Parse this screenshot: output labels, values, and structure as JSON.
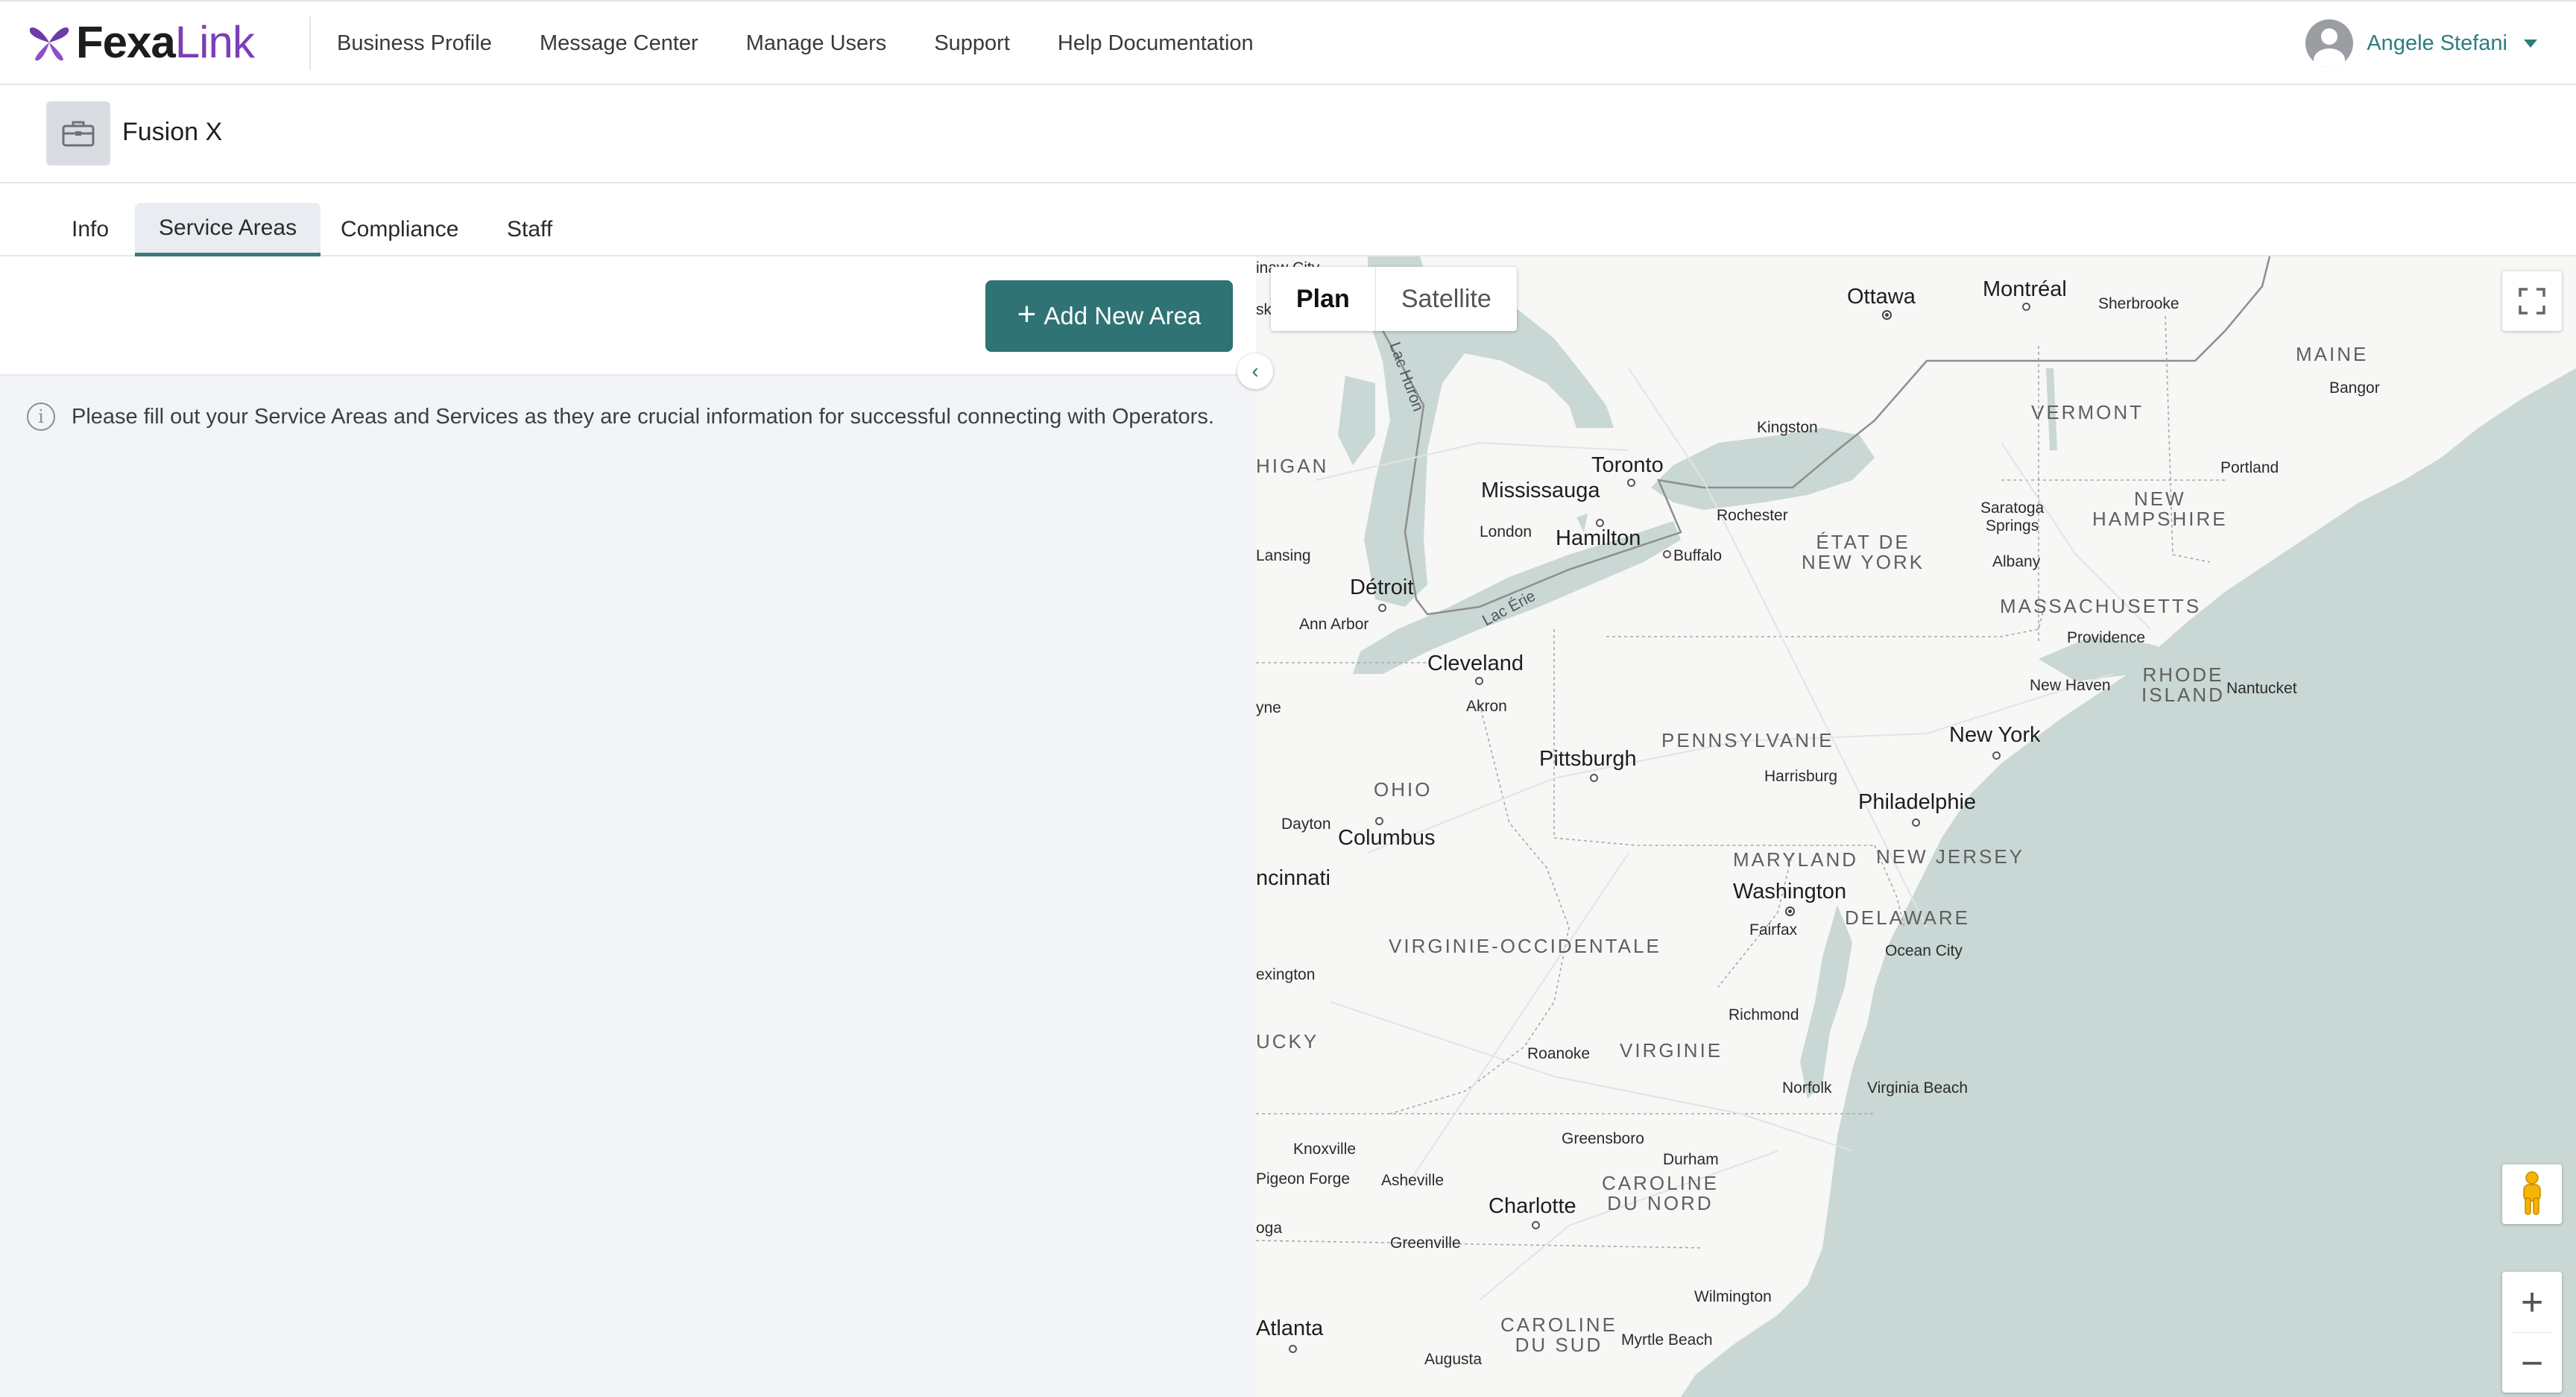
{
  "brand": {
    "part1": "Fexa",
    "part2": "Link",
    "accent": "#7b3fb6"
  },
  "nav": {
    "items": [
      "Business Profile",
      "Message Center",
      "Manage Users",
      "Support",
      "Help Documentation"
    ],
    "user_name": "Angele Stefani"
  },
  "business": {
    "name": "Fusion X",
    "icon": "briefcase-icon"
  },
  "tabs": [
    {
      "label": "Info",
      "active": false
    },
    {
      "label": "Service Areas",
      "active": true
    },
    {
      "label": "Compliance",
      "active": false
    },
    {
      "label": "Staff",
      "active": false
    }
  ],
  "panel": {
    "add_button": "Add New Area",
    "info_message": "Please fill out your Service Areas and Services as they are crucial information for successful connecting with Operators."
  },
  "map": {
    "type_options": {
      "plan": "Plan",
      "satellite": "Satellite",
      "selected": "Plan"
    },
    "colors": {
      "land": "#f7f7f5",
      "water": "#c9d7d5",
      "accent": "#2f7374"
    },
    "labels": {
      "ottawa": "Ottawa",
      "montreal": "Montréal",
      "sherbrooke": "Sherbrooke",
      "maine": "MAINE",
      "bangor": "Bangor",
      "vermont": "VERMONT",
      "kingston": "Kingston",
      "toronto": "Toronto",
      "mississauga": "Mississauga",
      "hamilton": "Hamilton",
      "london": "London",
      "rochester": "Rochester",
      "buffalo": "Buffalo",
      "saratoga": "Saratoga\nSprings",
      "new_hampshire": "NEW\nHAMPSHIRE",
      "portland": "Portland",
      "etat_ny": "ÉTAT DE\nNEW YORK",
      "albany": "Albany",
      "lansing": "Lansing",
      "detroit": "Détroit",
      "ann_arbor": "Ann Arbor",
      "lac_erie": "Lac Érie",
      "lac_huron": "Lac Huron",
      "higan": "HIGAN",
      "massachusetts": "MASSACHUSETTS",
      "providence": "Providence",
      "rhode_island": "RHODE\nISLAND",
      "nantucket": "Nantucket",
      "cleveland": "Cleveland",
      "new_haven": "New Haven",
      "akron": "Akron",
      "yne": "yne",
      "new_york": "New York",
      "pennsylvanie": "PENNSYLVANIE",
      "pittsburgh": "Pittsburgh",
      "harrisburg": "Harrisburg",
      "ohio": "OHIO",
      "philadelphie": "Philadelphie",
      "dayton": "Dayton",
      "columbus": "Columbus",
      "maryland": "MARYLAND",
      "new_jersey": "NEW JERSEY",
      "ncinnati": "ncinnati",
      "washington": "Washington",
      "delaware": "DELAWARE",
      "fairfax": "Fairfax",
      "virginie_occ": "VIRGINIE-OCCIDENTALE",
      "ocean_city": "Ocean City",
      "exington": "exington",
      "richmond": "Richmond",
      "ucky": "UCKY",
      "roanoke": "Roanoke",
      "virginie": "VIRGINIE",
      "norfolk": "Norfolk",
      "virginia_beach": "Virginia Beach",
      "greensboro": "Greensboro",
      "knoxville": "Knoxville",
      "durham": "Durham",
      "pigeon_forge": "Pigeon Forge",
      "asheville": "Asheville",
      "caroline_nord": "CAROLINE\nDU NORD",
      "charlotte": "Charlotte",
      "oga": "oga",
      "greenville": "Greenville",
      "wilmington": "Wilmington",
      "atlanta": "Atlanta",
      "caroline_sud": "CAROLINE\nDU SUD",
      "myrtle_beach": "Myrtle Beach",
      "augusta": "Augusta",
      "sk": "sk",
      "iaw_city": "inaw City"
    }
  }
}
